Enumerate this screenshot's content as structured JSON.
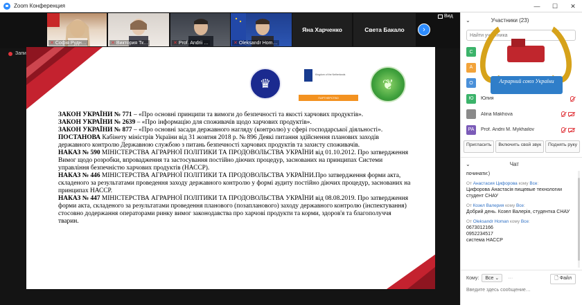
{
  "window": {
    "title": "Zoom Конференция",
    "controls": [
      "—",
      "☐",
      "✕"
    ]
  },
  "thumbnails": [
    {
      "name": "Софія Рудн…"
    },
    {
      "name": "Виктория Тк…"
    },
    {
      "name": "Prof. Andrii …"
    },
    {
      "name": "Oleksandr Hom…"
    }
  ],
  "text_tiles": [
    "Яна Харченко",
    "Света Бакало"
  ],
  "view_label": "Вид",
  "recording_label": "Запись",
  "slide": {
    "logo_b_caption": "Kingdom of the Netherlands",
    "logo_b_bar": "ПАРТНЕРСТВО",
    "paragraphs": [
      {
        "bold": "ЗАКОН УКРАЇНИ № 771",
        "text": " – «Про основні принципи та вимоги до безпечності та якості харчових продуктів»."
      },
      {
        "bold": "ЗАКОН УКРАЇНИ № 2639",
        "text": " – «Про інформацію для споживачів щодо харчових продуктів»."
      },
      {
        "bold": "ЗАКОН УКРАЇНИ № 877",
        "text": " – «Про основні засади державного нагляду (контролю) у сфері господарської діяльності»."
      },
      {
        "bold": "ПОСТАНОВА",
        "text": " Кабінету міністрів України від 31 жовтня 2018 р. № 896 Деякі питання здійснення планових заходів державного контролю Державною службою з питань безпечності харчових продуктів та захисту споживачів."
      },
      {
        "bold": "НАКАЗ  № 590",
        "text": " МІНІСТЕРСТВА АГРАРНОЇ ПОЛІТИКИ ТА ПРОДОВОЛЬСТВА УКРАЇНИ від 01.10.2012. Про затвердження Вимог щодо розробки, впровадження та застосування постійно діючих процедур, заснованих на принципах Системи управління безпечністю харчових продуктів (НАССР)."
      },
      {
        "bold": "НАКАЗ № 446",
        "text": " МІНІСТЕРСТВА АГРАРНОЇ ПОЛІТИКИ ТА ПРОДОВОЛЬСТВА УКРАЇНИ.Про затвердження форми акта, складеного за результатами проведення заходу державного контролю у формі аудиту постійно діючих процедур, заснованих на принципах НАССР."
      },
      {
        "bold": "НАКАЗ № 447",
        "text": " МІНІСТЕРСТВА АГРАРНОЇ ПОЛІТИКИ ТА ПРОДОВОЛЬСТВА УКРАЇНИ від 08.08.2019. Про затвердження форми акта, складеного за результатами проведення планового (позапланового) заходу державного контролю (інспектування) стосовно додержання операторами ринку вимог законодавства про харчові продукти та корми, здоров'я та благополуччя тварин."
      }
    ]
  },
  "participants": {
    "title": "Участники (23)",
    "search_placeholder": "Найти участника",
    "badge_ribbon": "Аграрний союз України",
    "list": [
      {
        "initial": "С",
        "name": "",
        "color": "#3bb36a"
      },
      {
        "initial": "А",
        "name": "",
        "color": "#f2a33a"
      },
      {
        "initial": "О",
        "name": "",
        "color": "#4a90d9"
      },
      {
        "initial": "Ю",
        "name": "Юлия",
        "color": "#3bb36a"
      },
      {
        "initial": "",
        "name": "Alina Makhova",
        "color": "#8a8a8a"
      },
      {
        "initial": "PA",
        "name": "Prof. Andrii M. Mykhailov",
        "color": "#7b5bb8"
      }
    ],
    "actions": [
      "Пригласить",
      "Включить свой звук",
      "Поднять руку"
    ]
  },
  "chat": {
    "title": "Чат",
    "messages": [
      {
        "from": "",
        "to": "",
        "text": "починати:)"
      },
      {
        "from": "Анастасия Цифорова",
        "to": "Все",
        "text": "Цифорова Анастасія пищевые технологии студент СНАУ"
      },
      {
        "from": "Козел Валерия",
        "to": "Все",
        "text": "Добрий день. Козел Валерія, студентка СНАУ"
      },
      {
        "from": "Oleksandr Homan",
        "to": "Все",
        "text": "0673012166\n0952234517\nсистема НАССР"
      }
    ],
    "from_prefix": "От",
    "to_word": "кому",
    "to_label": "Кому:",
    "to_value": "Все",
    "file_label": "Файл",
    "input_placeholder": "Введите здесь сообщение…"
  }
}
